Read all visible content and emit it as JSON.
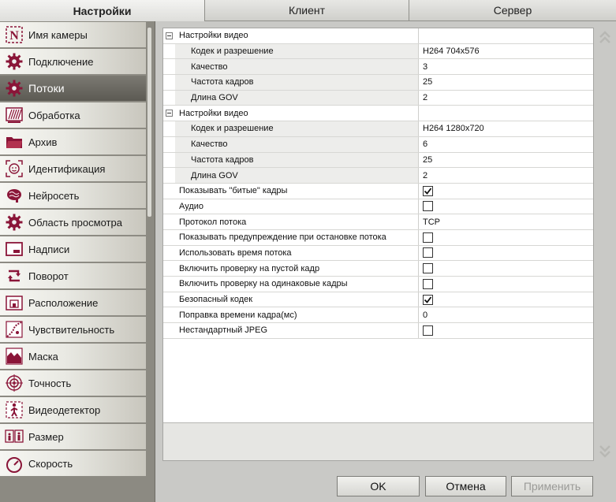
{
  "tabs": [
    {
      "label": "Настройки",
      "active": true
    },
    {
      "label": "Клиент",
      "active": false
    },
    {
      "label": "Сервер",
      "active": false
    }
  ],
  "sidebar": {
    "items": [
      {
        "label": "Имя камеры",
        "icon": "camera-name-icon"
      },
      {
        "label": "Подключение",
        "icon": "gear-icon"
      },
      {
        "label": "Потоки",
        "icon": "gear-icon",
        "selected": true
      },
      {
        "label": "Обработка",
        "icon": "processing-icon"
      },
      {
        "label": "Архив",
        "icon": "folder-icon"
      },
      {
        "label": "Идентификация",
        "icon": "face-icon"
      },
      {
        "label": "Нейросеть",
        "icon": "brain-icon"
      },
      {
        "label": "Область просмотра",
        "icon": "gear-icon"
      },
      {
        "label": "Надписи",
        "icon": "caption-icon"
      },
      {
        "label": "Поворот",
        "icon": "rotate-icon"
      },
      {
        "label": "Расположение",
        "icon": "location-icon"
      },
      {
        "label": "Чувствительность",
        "icon": "sensitivity-icon"
      },
      {
        "label": "Маска",
        "icon": "mask-icon"
      },
      {
        "label": "Точность",
        "icon": "target-icon"
      },
      {
        "label": "Видеодетектор",
        "icon": "person-icon"
      },
      {
        "label": "Размер",
        "icon": "size-icon"
      },
      {
        "label": "Скорость",
        "icon": "speed-icon"
      }
    ]
  },
  "grid": {
    "rows": [
      {
        "type": "group",
        "name": "Настройки видео",
        "value": ""
      },
      {
        "type": "child",
        "name": "Кодек и разрешение",
        "value": "H264 704x576"
      },
      {
        "type": "child",
        "name": "Качество",
        "value": "3"
      },
      {
        "type": "child",
        "name": "Частота кадров",
        "value": "25"
      },
      {
        "type": "child",
        "name": "Длина GOV",
        "value": "2"
      },
      {
        "type": "group",
        "name": "Настройки видео",
        "value": ""
      },
      {
        "type": "child",
        "name": "Кодек и разрешение",
        "value": "H264 1280x720"
      },
      {
        "type": "child",
        "name": "Качество",
        "value": "6"
      },
      {
        "type": "child",
        "name": "Частота кадров",
        "value": "25"
      },
      {
        "type": "child",
        "name": "Длина GOV",
        "value": "2"
      },
      {
        "type": "check",
        "name": "Показывать \"битые\" кадры",
        "checked": true
      },
      {
        "type": "check",
        "name": "Аудио",
        "checked": false
      },
      {
        "type": "text",
        "name": "Протокол потока",
        "value": "TCP"
      },
      {
        "type": "check",
        "name": "Показывать предупреждение при остановке потока",
        "checked": false
      },
      {
        "type": "check",
        "name": "Использовать время потока",
        "checked": false
      },
      {
        "type": "check",
        "name": "Включить проверку на пустой кадр",
        "checked": false
      },
      {
        "type": "check",
        "name": "Включить проверку на одинаковые кадры",
        "checked": false
      },
      {
        "type": "check",
        "name": "Безопасный кодек",
        "checked": true
      },
      {
        "type": "text",
        "name": "Поправка времени кадра(мс)",
        "value": "0"
      },
      {
        "type": "check",
        "name": "Нестандартный JPEG",
        "checked": false
      }
    ]
  },
  "buttons": {
    "ok": "OK",
    "cancel": "Отмена",
    "apply": "Применить"
  },
  "colors": {
    "icon_accent": "#8a1538",
    "sidebar_bg": "#8c8a82"
  }
}
